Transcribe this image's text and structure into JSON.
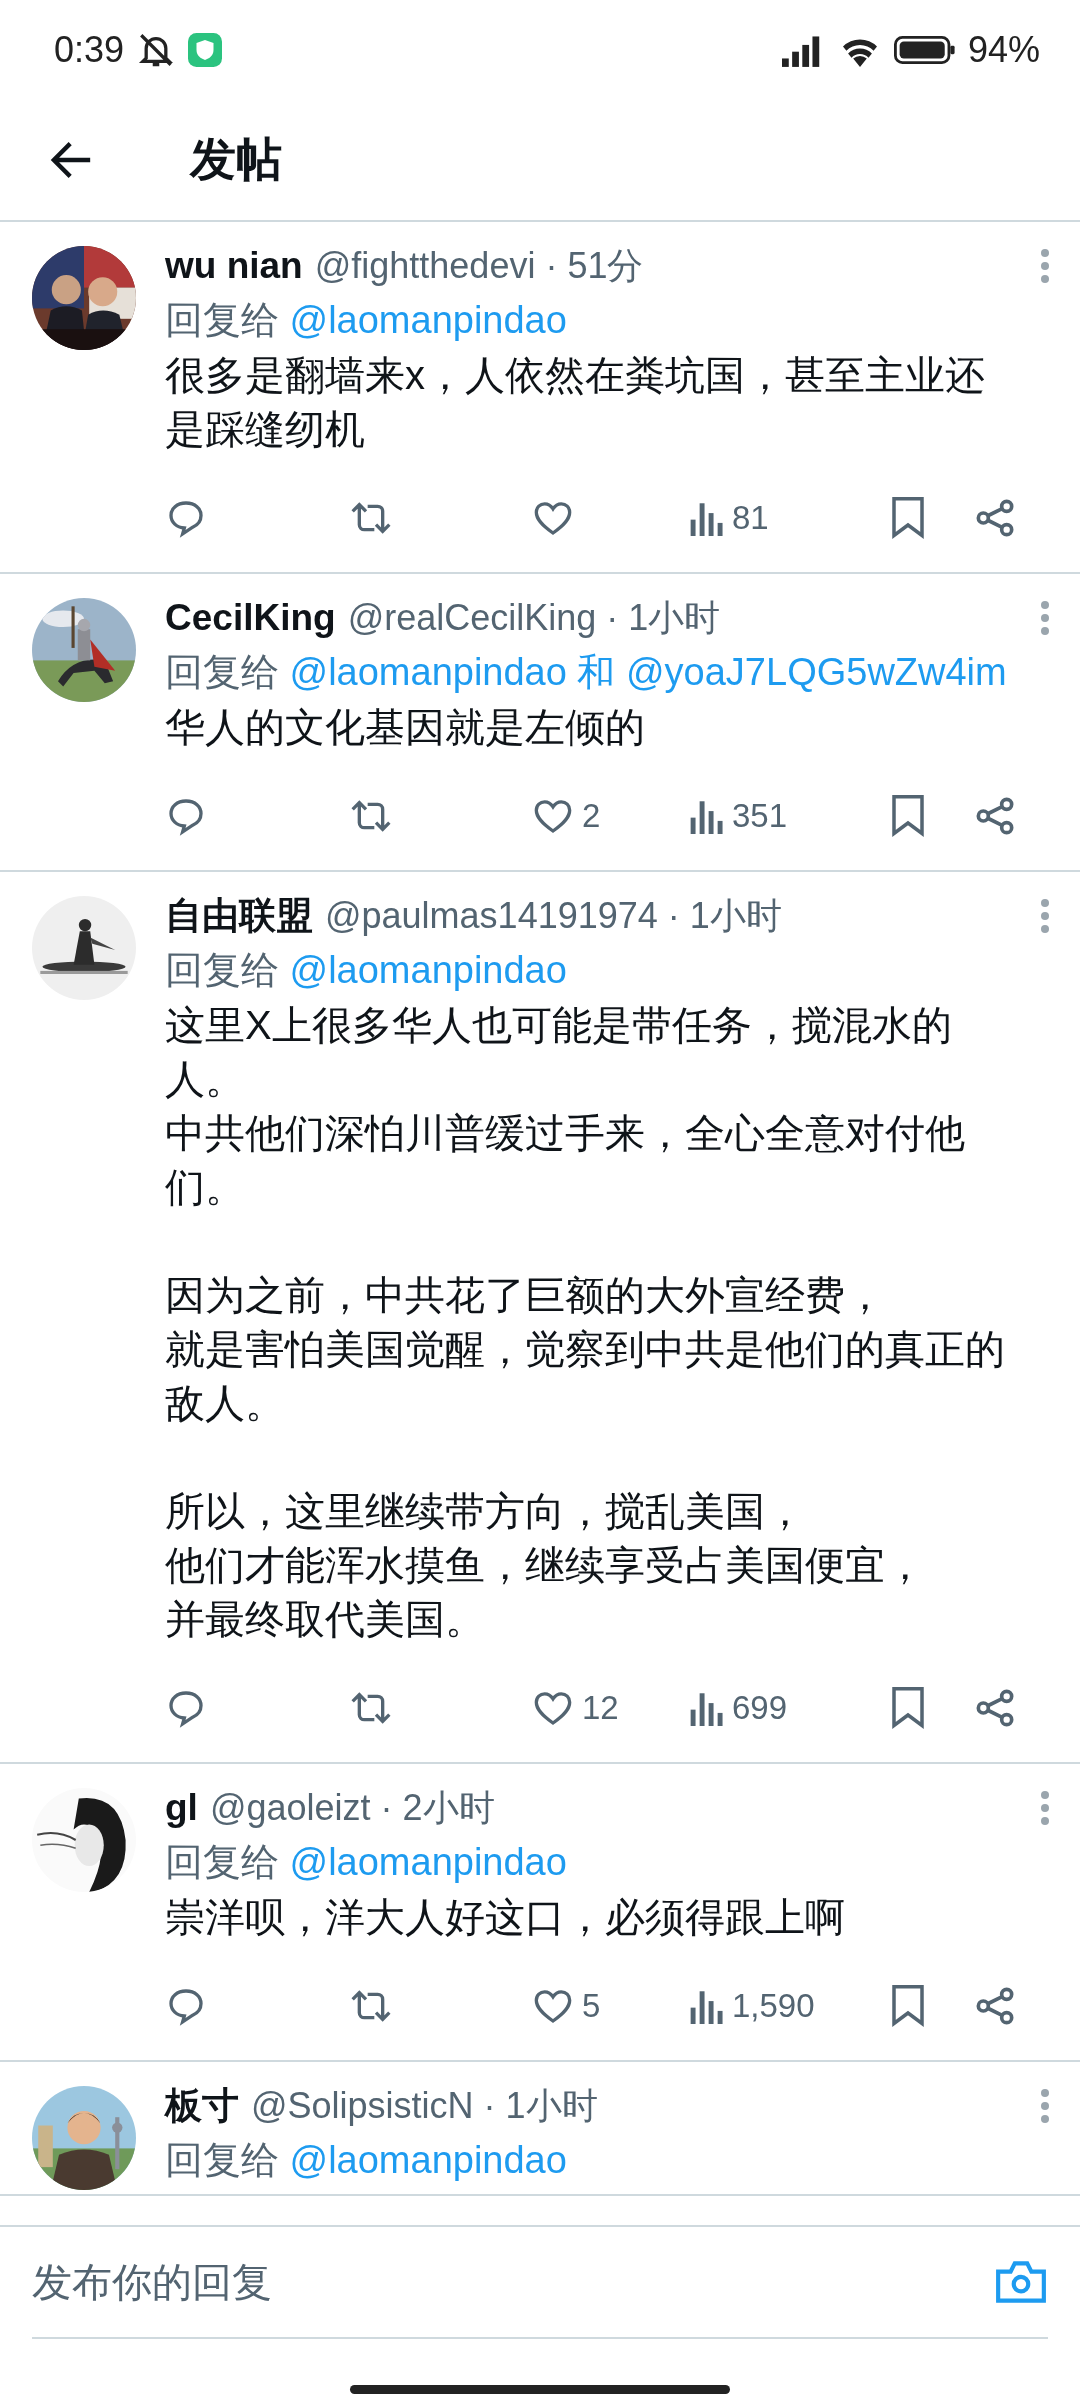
{
  "status_bar": {
    "time": "0:39",
    "battery": "94%"
  },
  "header": {
    "title": "发帖"
  },
  "posts": [
    {
      "avatar": {
        "kind": "picture"
      },
      "name": "wu nian",
      "handle": "@fightthedevi",
      "time": "· 51分",
      "reply_label": "回复给",
      "mentions": [
        "@laomanpindao"
      ],
      "text": "很多是翻墙来x，人依然在粪坑国，甚至主业还是踩缝纫机",
      "views": "81"
    },
    {
      "avatar": {
        "kind": "picture"
      },
      "name": "CecilKing",
      "handle": "@realCecilKing",
      "time": "· 1小时",
      "reply_label": "回复给",
      "mentions": [
        "@laomanpindao",
        "@yoaJ7LQG5wZw4im"
      ],
      "joiner": "和",
      "text": "华人的文化基因就是左倾的",
      "likes": "2",
      "views": "351"
    },
    {
      "avatar": {
        "kind": "picture"
      },
      "name": "自由联盟",
      "handle": "@paulmas14191974",
      "time": "· 1小时",
      "reply_label": "回复给",
      "mentions": [
        "@laomanpindao"
      ],
      "paragraphs": [
        [
          "这里X上很多华人也可能是带任务，搅混水的人。",
          "中共他们深怕川普缓过手来，全心全意对付他们。"
        ],
        [
          "因为之前，中共花了巨额的大外宣经费，",
          "就是害怕美国觉醒，觉察到中共是他们的真正的敌人。"
        ],
        [
          "所以，这里继续带方向，搅乱美国，",
          "他们才能浑水摸鱼，继续享受占美国便宜，",
          "并最终取代美国。"
        ]
      ],
      "likes": "12",
      "views": "699"
    },
    {
      "avatar": {
        "kind": "picture"
      },
      "name": "gl",
      "handle": "@gaoleizt",
      "time": "· 2小时",
      "reply_label": "回复给",
      "mentions": [
        "@laomanpindao"
      ],
      "text": "崇洋呗，洋大人好这口，必须得跟上啊",
      "likes": "5",
      "views": "1,590"
    },
    {
      "avatar": {
        "kind": "picture"
      },
      "name": "板寸",
      "handle": "@SolipsisticN",
      "time": "· 1小时",
      "reply_label": "回复给",
      "mentions": [
        "@laomanpindao"
      ]
    }
  ],
  "composer": {
    "placeholder": "发布你的回复"
  }
}
